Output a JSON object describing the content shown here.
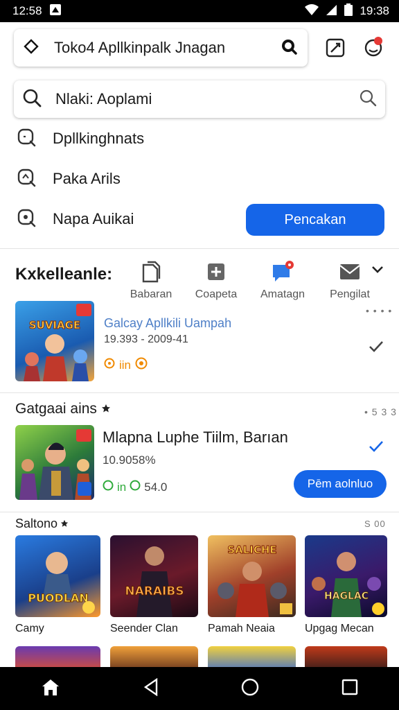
{
  "status": {
    "time": "12:58",
    "clock_right": "19:38"
  },
  "topbar": {
    "title": "Toko4 Apllkinpalk Jnagan"
  },
  "search": {
    "value": "Nlaki: Aoplami"
  },
  "suggestions": [
    {
      "label": "Dpllkinghnats"
    },
    {
      "label": "Paka Arils"
    },
    {
      "label": "Napa Auikai"
    }
  ],
  "suggest_button": "Pencakan",
  "categories": {
    "title": "Kxkelleanle:",
    "items": [
      {
        "label": "Babaran",
        "icon": "file-icon"
      },
      {
        "label": "Coapeta",
        "icon": "plus-box-icon"
      },
      {
        "label": "Amatagn",
        "icon": "chat-icon"
      },
      {
        "label": "Pengilat",
        "icon": "mail-icon"
      }
    ]
  },
  "featured": {
    "title": "Galcay Apllkili Uampah",
    "meta": "19.393 - 2009-41",
    "badge": "iin",
    "dots": "• • • •"
  },
  "section1": {
    "title": "Gatgaai ains",
    "dots": "• 5 3 3",
    "app": {
      "title": "Mlapna Luphe Tiilm, Barıan",
      "meta": "10.9058%",
      "badge": "in",
      "badge_num": "54.0",
      "button": "Pēm aolnluo"
    }
  },
  "section2": {
    "title": "Saltono",
    "count": "S 00",
    "games": [
      {
        "label": "Camy",
        "art": "PUODLAN"
      },
      {
        "label": "Seender Clan",
        "art": "NARAIBS"
      },
      {
        "label": "Pamah Neaia",
        "art": "SALICHE"
      },
      {
        "label": "Upgag Mecan",
        "art": "HAGLAC"
      }
    ]
  },
  "colors": {
    "accent": "#1565e8",
    "badge_orange": "#f08a00",
    "badge_green": "#2eaa3a"
  }
}
